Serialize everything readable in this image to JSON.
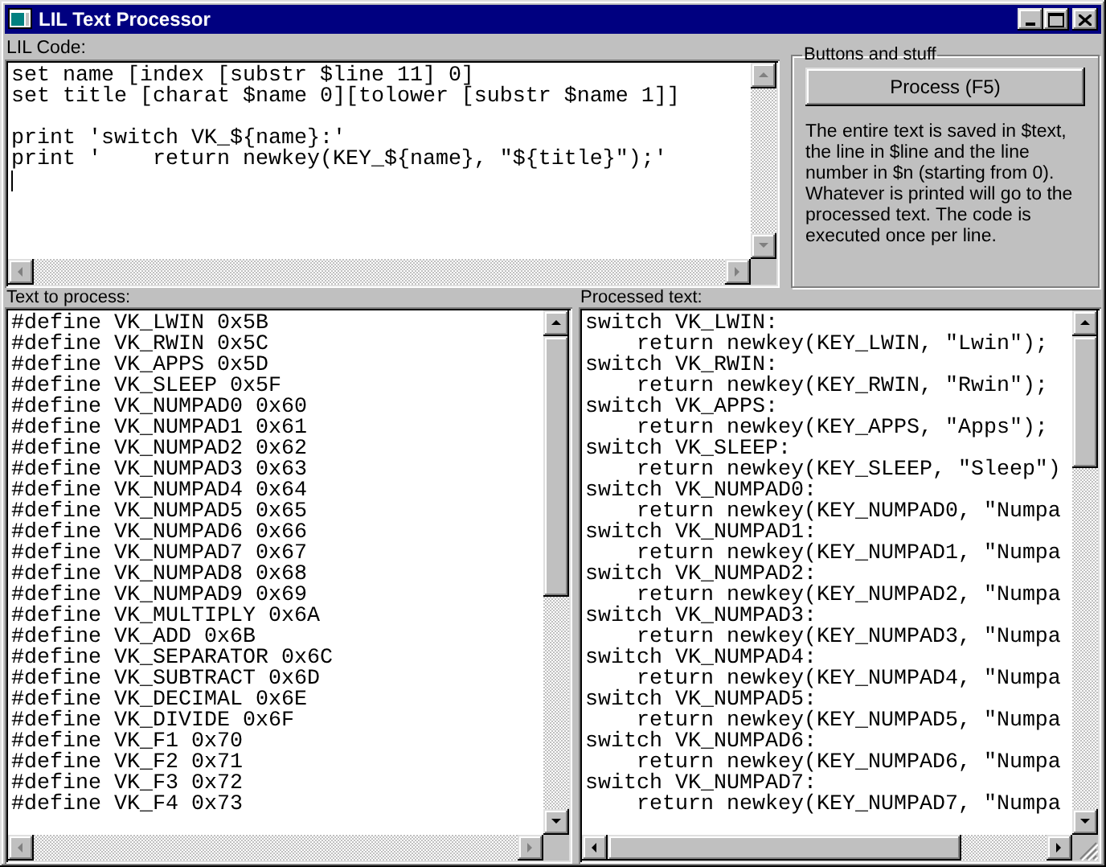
{
  "window": {
    "title": "LIL Text Processor"
  },
  "code_editor": {
    "label": "LIL Code:",
    "text": "set name [index [substr $line 11] 0]\nset title [charat $name 0][tolower [substr $name 1]]\n\nprint 'switch VK_${name}:'\nprint '    return newkey(KEY_${name}, \"${title}\");'"
  },
  "group": {
    "title": "Buttons and stuff",
    "button": "Process (F5)",
    "help": "The entire text is saved in $text, the line in $line and the line number in $n (starting from 0). Whatever is printed will go to the processed text. The code is executed once per line."
  },
  "input_editor": {
    "label": "Text to process:",
    "text": "#define VK_LWIN 0x5B\n#define VK_RWIN 0x5C\n#define VK_APPS 0x5D\n#define VK_SLEEP 0x5F\n#define VK_NUMPAD0 0x60\n#define VK_NUMPAD1 0x61\n#define VK_NUMPAD2 0x62\n#define VK_NUMPAD3 0x63\n#define VK_NUMPAD4 0x64\n#define VK_NUMPAD5 0x65\n#define VK_NUMPAD6 0x66\n#define VK_NUMPAD7 0x67\n#define VK_NUMPAD8 0x68\n#define VK_NUMPAD9 0x69\n#define VK_MULTIPLY 0x6A\n#define VK_ADD 0x6B\n#define VK_SEPARATOR 0x6C\n#define VK_SUBTRACT 0x6D\n#define VK_DECIMAL 0x6E\n#define VK_DIVIDE 0x6F\n#define VK_F1 0x70\n#define VK_F2 0x71\n#define VK_F3 0x72\n#define VK_F4 0x73"
  },
  "output_editor": {
    "label": "Processed text:",
    "text": "switch VK_LWIN:\n    return newkey(KEY_LWIN, \"Lwin\");\nswitch VK_RWIN:\n    return newkey(KEY_RWIN, \"Rwin\");\nswitch VK_APPS:\n    return newkey(KEY_APPS, \"Apps\");\nswitch VK_SLEEP:\n    return newkey(KEY_SLEEP, \"Sleep\")\nswitch VK_NUMPAD0:\n    return newkey(KEY_NUMPAD0, \"Numpa\nswitch VK_NUMPAD1:\n    return newkey(KEY_NUMPAD1, \"Numpa\nswitch VK_NUMPAD2:\n    return newkey(KEY_NUMPAD2, \"Numpa\nswitch VK_NUMPAD3:\n    return newkey(KEY_NUMPAD3, \"Numpa\nswitch VK_NUMPAD4:\n    return newkey(KEY_NUMPAD4, \"Numpa\nswitch VK_NUMPAD5:\n    return newkey(KEY_NUMPAD5, \"Numpa\nswitch VK_NUMPAD6:\n    return newkey(KEY_NUMPAD6, \"Numpa\nswitch VK_NUMPAD7:\n    return newkey(KEY_NUMPAD7, \"Numpa"
  }
}
